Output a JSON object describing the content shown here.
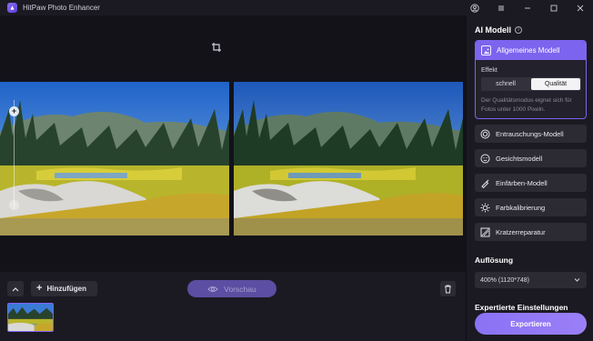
{
  "app": {
    "title": "HitPaw Photo Enhancer"
  },
  "toolbar": {
    "add_label": "Hinzufügen",
    "preview_label": "Vorschau"
  },
  "panel": {
    "ai_title": "AI Modell",
    "selected_model": "Allgemeines Modell",
    "effect_label": "Effekt",
    "effect_options": [
      "schnell",
      "Qualität"
    ],
    "effect_selected": "Qualität",
    "description": "Der Qualitätsmodus eignet sich für Fotos unter 1000 Pixeln.",
    "models": [
      {
        "label": "Entrauschungs-Modell",
        "icon": "denoise-icon"
      },
      {
        "label": "Gesichtsmodell",
        "icon": "face-icon"
      },
      {
        "label": "Einfärben-Modell",
        "icon": "colorize-icon"
      },
      {
        "label": "Farbkalibrierung",
        "icon": "color-calibration-icon"
      },
      {
        "label": "Kratzerreparatur",
        "icon": "scratch-repair-icon"
      }
    ],
    "resolution_title": "Auflösung",
    "resolution_value": "400% (1120*748)",
    "expert_title": "Expertierte Einstellungen",
    "export_label": "Exportieren"
  },
  "colors": {
    "accent": "#7d64ee",
    "panel": "#1b1a22",
    "canvas": "#131219"
  }
}
